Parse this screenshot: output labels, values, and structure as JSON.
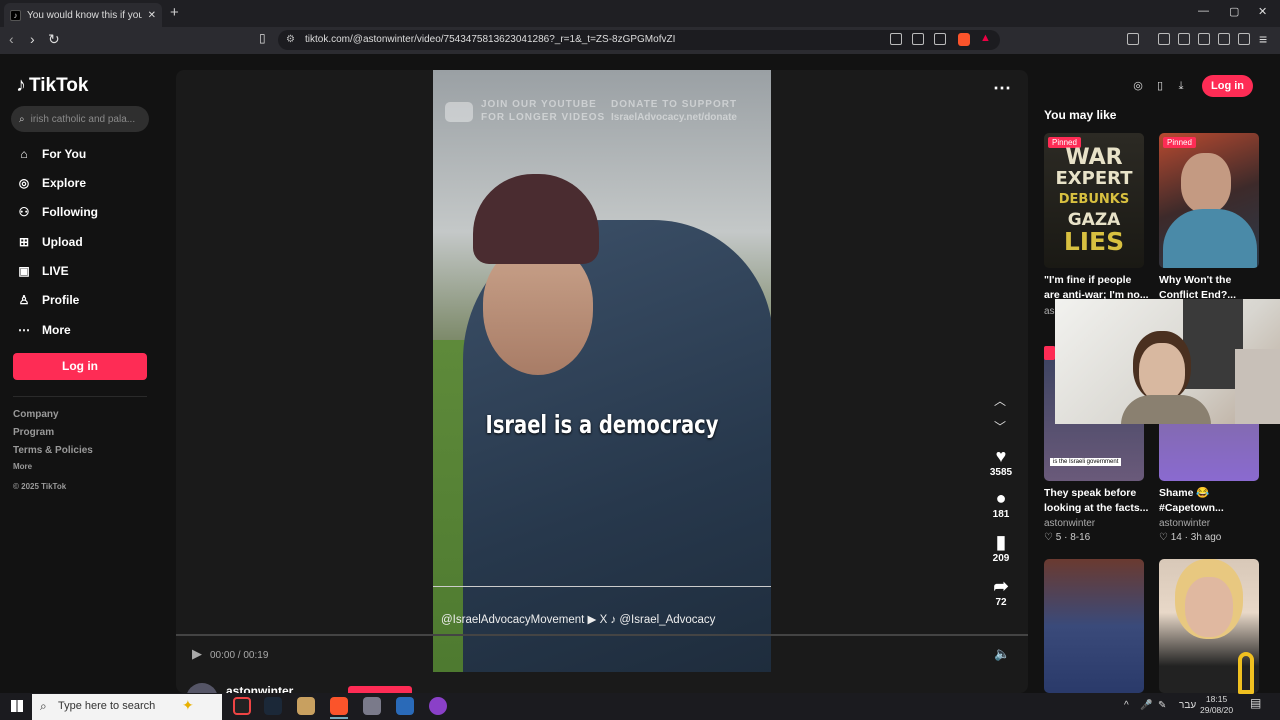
{
  "browser": {
    "tab_title": "You would know this if you didn",
    "tab_close": "✕",
    "new_tab": "+",
    "url": "tiktok.com/@astonwinter/video/7543475813623041286?_r=1&_t=ZS-8zGPGMofvZI",
    "window_controls": [
      "—",
      "▢",
      "✕"
    ]
  },
  "tiktok": {
    "logo": "TikTok",
    "search_placeholder": "irish catholic and pala...",
    "nav": [
      {
        "label": "For You",
        "icon": "home-icon"
      },
      {
        "label": "Explore",
        "icon": "compass-icon"
      },
      {
        "label": "Following",
        "icon": "following-icon"
      },
      {
        "label": "Upload",
        "icon": "upload-icon"
      },
      {
        "label": "LIVE",
        "icon": "live-icon"
      },
      {
        "label": "Profile",
        "icon": "profile-icon"
      },
      {
        "label": "More",
        "icon": "more-icon"
      }
    ],
    "login_label": "Log in",
    "footer": {
      "company": "Company",
      "program": "Program",
      "terms": "Terms & Policies",
      "more": "More",
      "copyright": "© 2025 TikTok"
    }
  },
  "video": {
    "watermark_left": "JOIN OUR YOUTUBE",
    "watermark_left2": "FOR LONGER VIDEOS",
    "watermark_right": "DONATE TO SUPPORT",
    "watermark_right2": "IsraelAdvocacy.net/donate",
    "caption": "Israel is a democracy",
    "handles": "@IsraelAdvocacyMovement   ▶ X ♪ @Israel_Advocacy",
    "likes": "3585",
    "comments": "181",
    "saves": "209",
    "shares": "72",
    "time": "00:00 / 00:19",
    "progress_fraction": 0.0,
    "author": "astonwinter"
  },
  "right_panel": {
    "login_label": "Log in",
    "heading": "You may like",
    "cards": [
      {
        "pinned": "Pinned",
        "title": "\"I'm fine if people",
        "title2": "are anti-war; I'm no...",
        "author": "as",
        "thumb_text": [
          "WAR",
          "EXPERT",
          "DEBUNKS",
          "GAZA",
          "LIES"
        ]
      },
      {
        "pinned": "Pinned",
        "title": "Why Won't the",
        "title2": "Conflict End?..."
      },
      {
        "title": "They speak before",
        "title2": "looking at the facts...",
        "author": "astonwinter",
        "stats": "♡ 5  ·  8-16",
        "thumb_caption": "is the Israeli government"
      },
      {
        "title": "Shame 😂",
        "title2": "#Capetown...",
        "author": "astonwinter",
        "stats": "♡ 14  ·  3h ago"
      }
    ]
  },
  "taskbar": {
    "search_placeholder": "Type here to search",
    "lang": "עבר",
    "time": "18:15",
    "date": "29/08/20"
  }
}
